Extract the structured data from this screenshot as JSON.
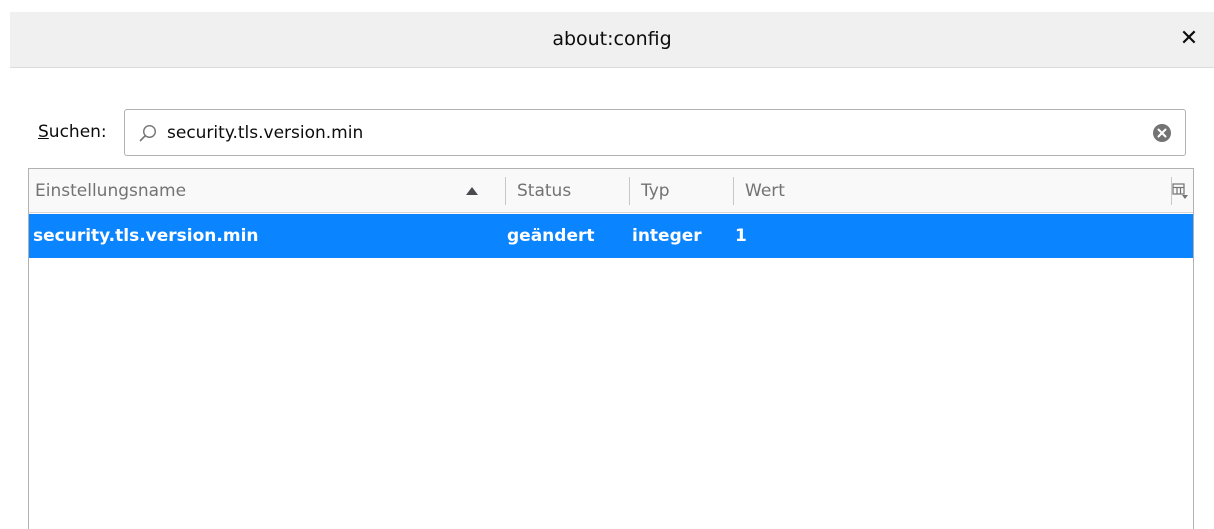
{
  "window": {
    "title": "about:config",
    "close_glyph": "✕"
  },
  "search": {
    "label_accel": "S",
    "label_rest": "uchen:",
    "value": "security.tls.version.min",
    "placeholder": "",
    "icon": "search-icon",
    "clear_icon": "clear-icon"
  },
  "table": {
    "sort_column": "Einstellungsname",
    "sort_direction": "ascending",
    "columns": [
      {
        "label": "Einstellungsname"
      },
      {
        "label": "Status"
      },
      {
        "label": "Typ"
      },
      {
        "label": "Wert"
      }
    ],
    "rows": [
      {
        "name": "security.tls.version.min",
        "status": "geändert",
        "type": "integer",
        "value": "1",
        "selected": true
      }
    ]
  },
  "colors": {
    "selection": "#0a84ff",
    "selection_text": "#ffffff",
    "header_text": "#737373",
    "titlebar_bg": "#f0f0f0"
  }
}
